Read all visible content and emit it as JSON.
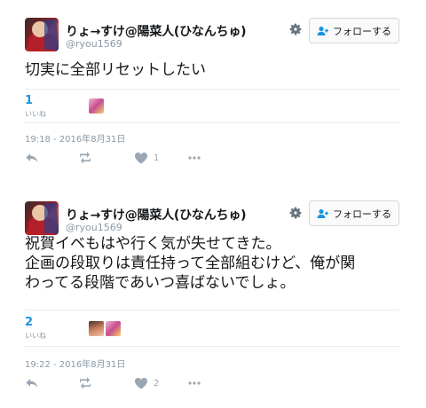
{
  "tweets": [
    {
      "display_name": "りょ→すけ@陽菜人(ひなんちゅ)",
      "handle": "@ryou1569",
      "follow_label": "フォローする",
      "text_lines": [
        "切実に全部リセットしたい"
      ],
      "likes_count": "1",
      "likes_label": "いいね",
      "timestamp": "19:18 - 2016年8月31日",
      "like_action_count": "1"
    },
    {
      "display_name": "りょ→すけ@陽菜人(ひなんちゅ)",
      "handle": "@ryou1569",
      "follow_label": "フォローする",
      "text_lines": [
        "祝賀イベもはや行く気が失せてきた。",
        "企画の段取りは責任持って全部組むけど、俺が関",
        "わってる段階であいつ喜ばないでしょ。"
      ],
      "likes_count": "2",
      "likes_label": "いいね",
      "timestamp": "19:22 - 2016年8月31日",
      "like_action_count": "2"
    }
  ],
  "icons": {
    "gear": "gear-icon",
    "follow": "follow-user-icon",
    "reply": "reply-icon",
    "retweet": "retweet-icon",
    "like": "heart-icon",
    "more": "more-icon"
  },
  "colors": {
    "link_blue": "#1b95e0",
    "muted": "#8899a6",
    "action_icon": "#9aa7b2"
  }
}
